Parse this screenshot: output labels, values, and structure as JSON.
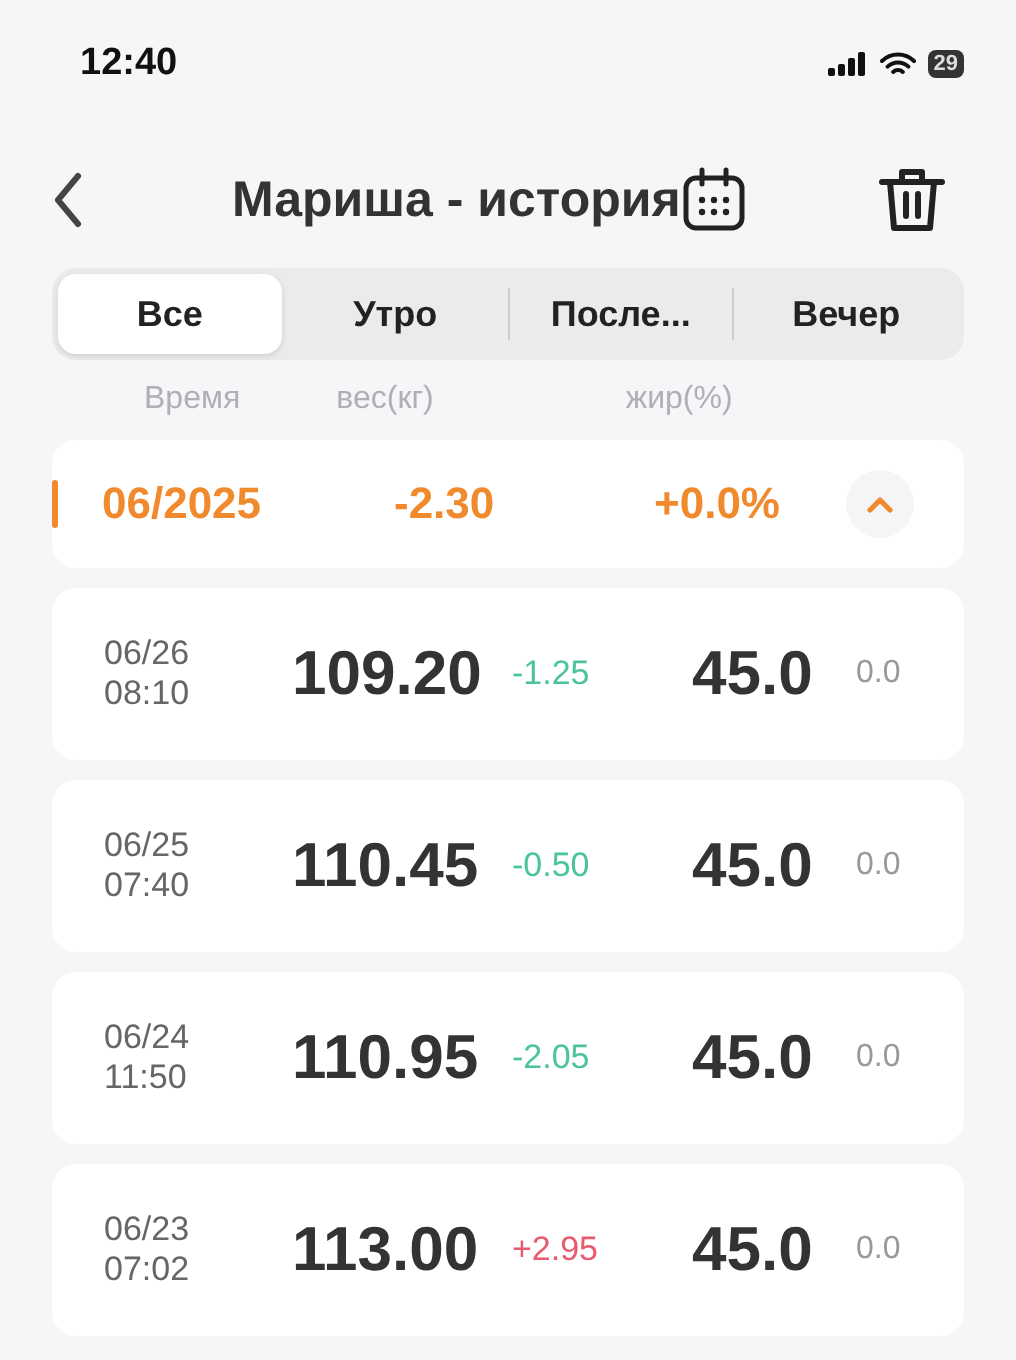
{
  "status_bar": {
    "time": "12:40",
    "battery": "29"
  },
  "header": {
    "title": "Мариша - история"
  },
  "tabs": [
    {
      "label": "Все",
      "selected": true
    },
    {
      "label": "Утро",
      "selected": false
    },
    {
      "label": "После...",
      "selected": false
    },
    {
      "label": "Вечер",
      "selected": false
    }
  ],
  "columns": [
    "Время",
    "вес(кг)",
    "жир(%)"
  ],
  "month": {
    "label": "06/2025",
    "weight_change": "-2.30",
    "fat_change": "+0.0%",
    "expanded": true
  },
  "rows": [
    {
      "date": "06/26",
      "time": "08:10",
      "weight": "109.20",
      "delta": "-1.25",
      "color": "#4cc49a",
      "fat": "45.0",
      "fat_delta": "0.0"
    },
    {
      "date": "06/25",
      "time": "07:40",
      "weight": "110.45",
      "delta": "-0.50",
      "color": "#4cc49a",
      "fat": "45.0",
      "fat_delta": "0.0"
    },
    {
      "date": "06/24",
      "time": "11:50",
      "weight": "110.95",
      "delta": "-2.05",
      "color": "#4cc49a",
      "fat": "45.0",
      "fat_delta": "0.0"
    },
    {
      "date": "06/23",
      "time": "07:02",
      "weight": "113.00",
      "delta": "+2.95",
      "color": "#e85a6e",
      "fat": "45.0",
      "fat_delta": "0.0"
    }
  ]
}
